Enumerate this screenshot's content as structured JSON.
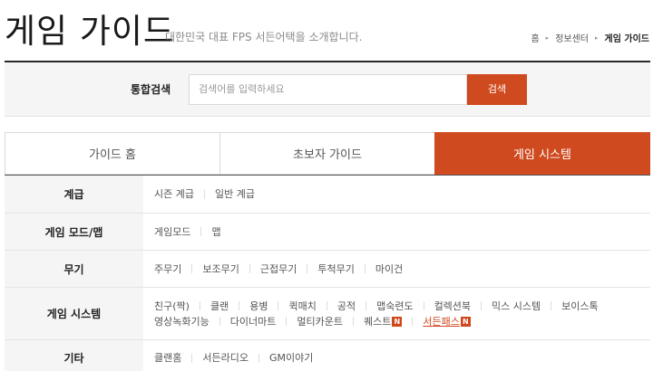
{
  "header": {
    "title": "게임 가이드",
    "subtitle": "대한민국 대표 FPS 서든어택을 소개합니다.",
    "breadcrumb": [
      "홈",
      "정보센터",
      "게임 가이드"
    ]
  },
  "search": {
    "label": "통합검색",
    "placeholder": "검색어를 입력하세요",
    "button_label": "검색"
  },
  "tabs": [
    {
      "label": "가이드 홈",
      "active": false
    },
    {
      "label": "초보자 가이드",
      "active": false
    },
    {
      "label": "게임 시스템",
      "active": true
    }
  ],
  "categories": [
    {
      "title": "계급",
      "links": [
        "시즌 계급",
        "일반 계급"
      ]
    },
    {
      "title": "게임 모드/맵",
      "links": [
        "게임모드",
        "맵"
      ]
    },
    {
      "title": "무기",
      "links": [
        "주무기",
        "보조무기",
        "근접무기",
        "투척무기",
        "마이건"
      ]
    },
    {
      "title": "게임 시스템",
      "links": [
        "친구(짝)",
        "클랜",
        "용병",
        "퀵매치",
        "공적",
        "맵숙련도",
        "컬렉션북",
        "믹스 시스템",
        "보이스톡",
        "영상녹화기능",
        "다이너마트",
        "멀티카운트",
        "퀘스트",
        "서든패스"
      ],
      "new_badge": "N"
    },
    {
      "title": "기타",
      "links": [
        "클랜홈",
        "서든라디오",
        "GM이야기"
      ]
    }
  ],
  "colors": {
    "accent": "#cf4a1f",
    "header_rule": "#2a2a2a",
    "panel_bg": "#f5f5f5"
  }
}
